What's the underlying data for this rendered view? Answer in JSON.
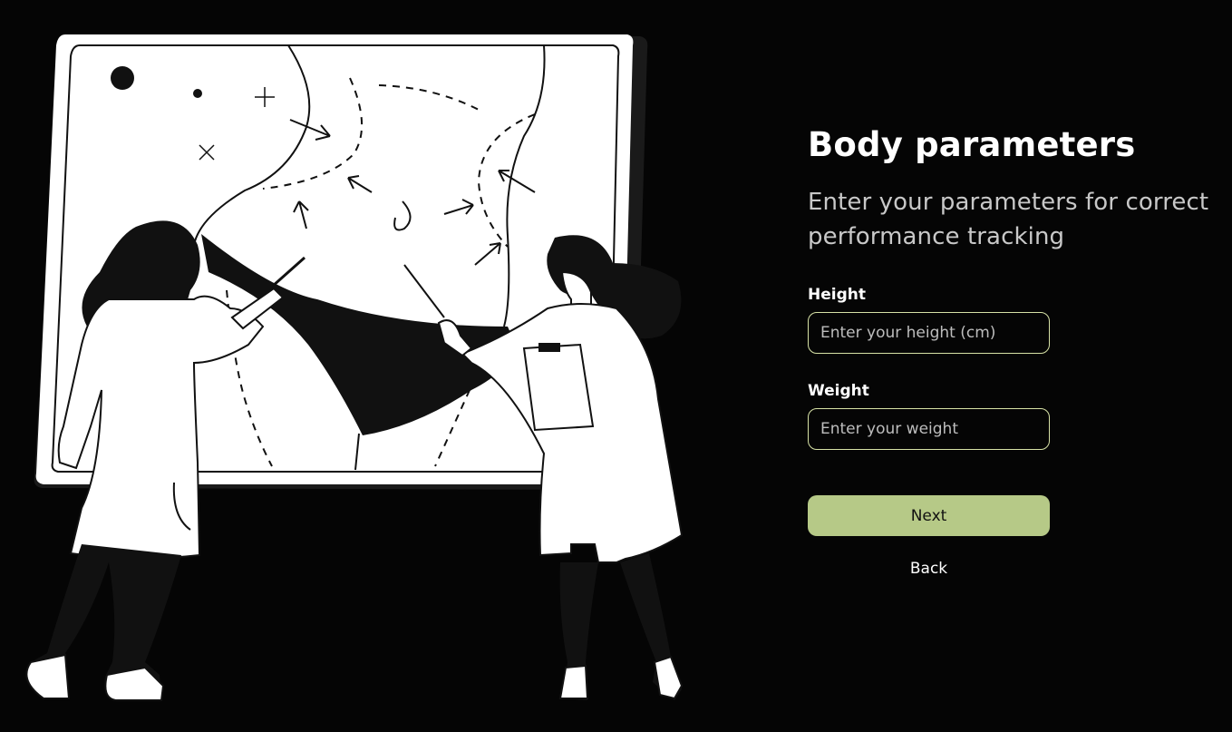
{
  "form": {
    "title": "Body parameters",
    "subtitle": "Enter your parameters for correct performance tracking",
    "height_label": "Height",
    "height_placeholder": "Enter your height (cm)",
    "height_value": "",
    "weight_label": "Weight",
    "weight_placeholder": "Enter your weight",
    "weight_value": "",
    "next_label": "Next",
    "back_label": "Back"
  },
  "colors": {
    "background": "#050505",
    "accent": "#b6c987",
    "input_border": "#d7e2a6",
    "subtitle": "#c8c8c8"
  },
  "illustration": {
    "icon": "two-scientists-at-board-illustration"
  }
}
